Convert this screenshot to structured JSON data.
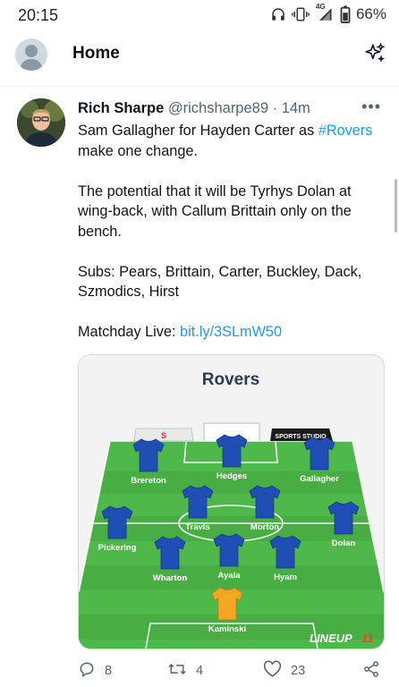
{
  "status_bar": {
    "time": "20:15",
    "network": "4G",
    "battery": "66%",
    "icons": [
      "headphones-icon",
      "vibrate-icon",
      "signal-icon",
      "battery-icon"
    ]
  },
  "header": {
    "title": "Home",
    "icons": [
      "avatar",
      "sparkle-icon"
    ]
  },
  "tweet": {
    "author_name": "Rich Sharpe",
    "handle": "@richsharpe89",
    "separator": "·",
    "time": "14m",
    "text_line1_a": "Sam Gallagher for Hayden Carter as ",
    "hashtag": "#Rovers",
    "text_line1_b": " make one change.",
    "text_para2": "The potential that it will be Tyrhys Dolan at wing-back, with Callum Brittain only on the bench.",
    "text_para3": "Subs: Pears, Brittain, Carter, Buckley, Dack, Szmodics, Hirst",
    "matchday_label": "Matchday Live: ",
    "matchday_link": "bit.ly/3SLmW50",
    "stats": {
      "replies": "8",
      "retweets": "4",
      "likes": "23"
    },
    "colors": {
      "link": "#1d9bf0",
      "muted": "#536471"
    }
  },
  "lineup_card": {
    "team_title": "Rovers",
    "sponsor": "SPORTS STUDIO",
    "brand": "LINEUP",
    "brand_num": "11",
    "colors": {
      "pitch": "#4fb84a",
      "shirt": "#1f4fb5",
      "keeper": "#f5a623",
      "title": "#2b3a55"
    },
    "players": [
      {
        "name": "Brereton",
        "role": "outfield"
      },
      {
        "name": "Hedges",
        "role": "outfield"
      },
      {
        "name": "Gallagher",
        "role": "outfield"
      },
      {
        "name": "Travis",
        "role": "outfield"
      },
      {
        "name": "Morton",
        "role": "outfield"
      },
      {
        "name": "Pickering",
        "role": "outfield"
      },
      {
        "name": "Dolan",
        "role": "outfield"
      },
      {
        "name": "Wharton",
        "role": "outfield"
      },
      {
        "name": "Ayala",
        "role": "outfield"
      },
      {
        "name": "Hyam",
        "role": "outfield"
      },
      {
        "name": "Kaminski",
        "role": "goalkeeper"
      }
    ]
  }
}
